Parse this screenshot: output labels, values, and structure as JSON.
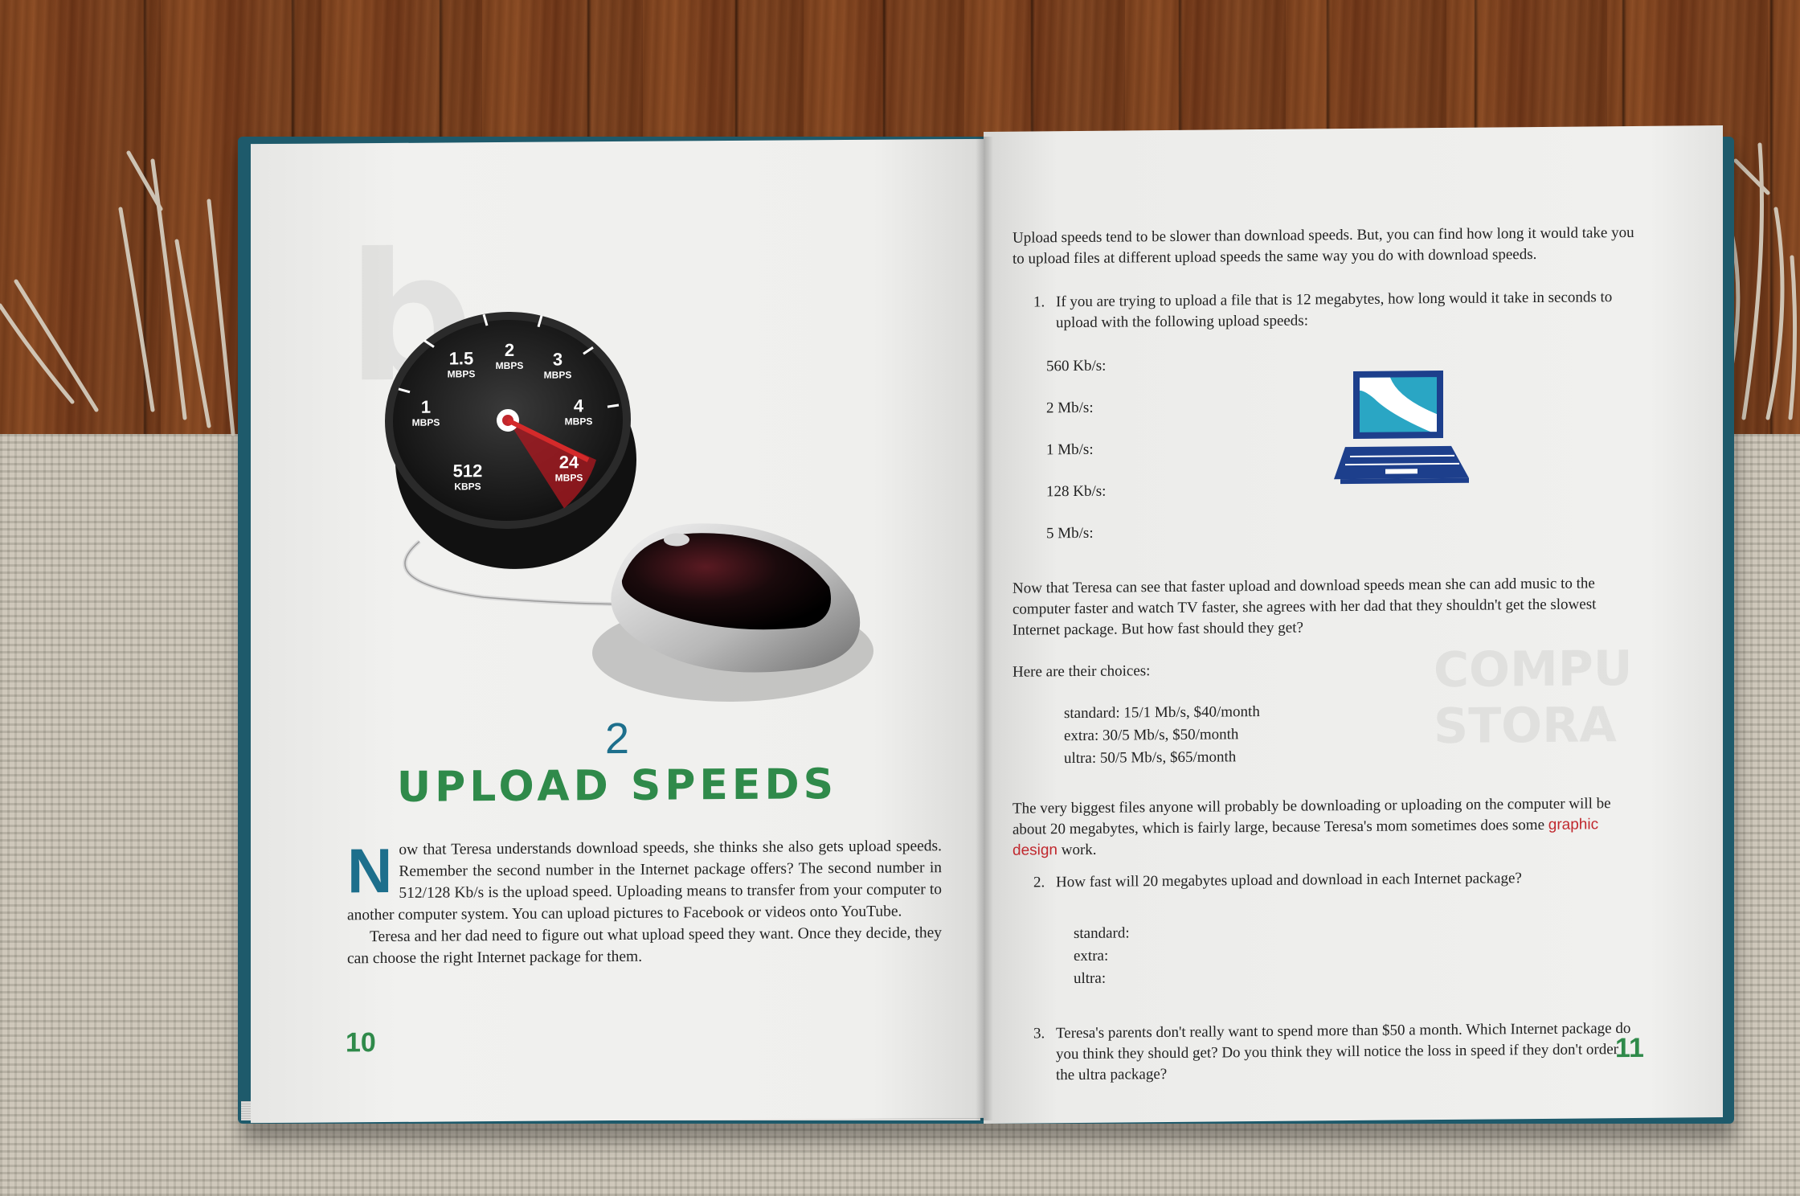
{
  "left_page": {
    "gauge": {
      "labels": [
        {
          "value": "1.5",
          "unit": "MBPS"
        },
        {
          "value": "2",
          "unit": "MBPS"
        },
        {
          "value": "3",
          "unit": "MBPS"
        },
        {
          "value": "1",
          "unit": "MBPS"
        },
        {
          "value": "4",
          "unit": "MBPS"
        },
        {
          "value": "512",
          "unit": "KBPS"
        },
        {
          "value": "24",
          "unit": "MBPS"
        }
      ]
    },
    "chapter_number": "2",
    "chapter_title": "UPLOAD SPEEDS",
    "dropcap": "N",
    "paragraph1": "ow that Teresa understands download speeds, she thinks she also gets upload speeds. Remember the second number in the Internet package offers? The second number in 512/128 Kb/s is the upload speed. Uploading means to transfer from your computer to another computer system. You can upload pictures to Facebook or videos onto YouTube.",
    "paragraph2": "Teresa and her dad need to figure out what upload speed they want. Once they decide, they can choose the right Internet package for them.",
    "page_number": "10"
  },
  "right_page": {
    "intro": "Upload speeds tend to be slower than download speeds. But, you can find how long it would take you to upload files at different upload speeds the same way you do with download speeds.",
    "q1_number": "1.",
    "q1_text": "If you are trying to upload a file that is 12 megabytes, how long would it take in seconds to upload with the following upload speeds:",
    "speeds": [
      "560 Kb/s:",
      "2 Mb/s:",
      "1 Mb/s:",
      "128 Kb/s:",
      "5 Mb/s:"
    ],
    "paragraph_teresa": "Now that Teresa can see that faster upload and download speeds mean she can add music to the computer faster and watch TV faster, she agrees with her dad that they shouldn't get the slowest Internet package. But how fast should they get?",
    "choices_intro": "Here are their choices:",
    "choices": [
      "standard: 15/1 Mb/s, $40/month",
      "extra: 30/5 Mb/s, $50/month",
      "ultra: 50/5 Mb/s, $65/month"
    ],
    "paragraph_files_a": "The very biggest files anyone will probably be downloading or uploading on the computer will be about 20 megabytes, which is fairly large, because Teresa's mom sometimes does some ",
    "paragraph_files_term": "graphic design",
    "paragraph_files_b": " work.",
    "q2_number": "2.",
    "q2_text": "How fast will 20 megabytes upload and download in each Internet package?",
    "q2_answers": [
      "standard:",
      "extra:",
      "ultra:"
    ],
    "q3_number": "3.",
    "q3_text": "Teresa's parents don't really want to spend more than $50 a month. Which Internet package do you think they should get? Do you think they will notice the loss in speed if they don't order the ultra package?",
    "page_number": "11"
  },
  "colors": {
    "title_green": "#2f8a4a",
    "chapter_blue": "#1d6f8c",
    "term_red": "#c0272d",
    "laptop_blue": "#1d3f8c",
    "laptop_teal": "#2aa6c4"
  },
  "icons": [
    "speed-gauge-icon",
    "computer-mouse-icon",
    "laptop-icon"
  ]
}
